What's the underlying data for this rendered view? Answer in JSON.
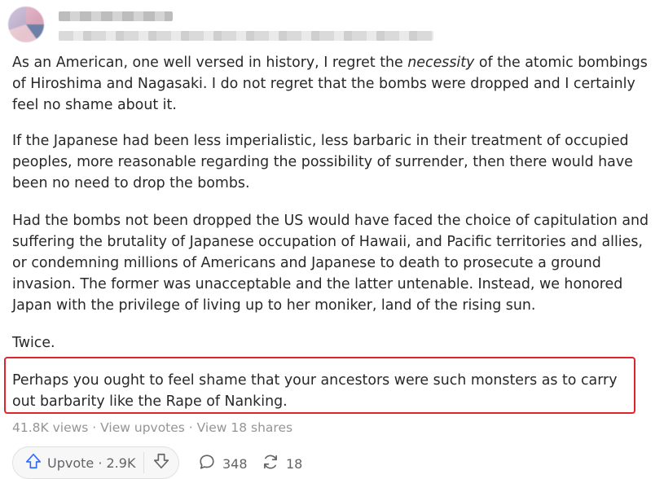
{
  "answer": {
    "paragraphs": {
      "p1_before": "As an American, one well versed in history, I regret the ",
      "p1_emph": "necessity",
      "p1_after": " of the atomic bombings of Hiroshima and Nagasaki. I do not regret that the bombs were dropped and I certainly feel no shame about it.",
      "p2": "If the Japanese had been less imperialistic, less barbaric in their treatment of occupied peoples, more reasonable regarding the possibility of surrender, then there would have been no need to drop the bombs.",
      "p3": "Had the bombs not been dropped the US would have faced the choice of capitulation and suffering the brutality of Japanese occupation of Hawaii, and Pacific territories and allies, or condemning millions of Americans and Japanese to death to prosecute a ground invasion. The former was unacceptable and the latter untenable. Instead, we honored Japan with the privilege of living up to her moniker, land of the rising sun.",
      "p4": "Twice.",
      "p5": "Perhaps you ought to feel shame that your ancestors were such monsters as to carry out barbarity like the Rape of Nanking."
    },
    "stats": {
      "views": "41.8K views",
      "sep1": " · ",
      "upvotes_link": "View upvotes",
      "sep2": " · ",
      "shares_link": "View 18 shares"
    },
    "actions": {
      "upvote_label": "Upvote · 2.9K",
      "comments_count": "348",
      "shares_count": "18"
    }
  },
  "colors": {
    "text": "#282829",
    "muted": "#939598",
    "highlight_border": "#e0242b",
    "upvote_icon": "#2e69ff"
  },
  "icons": [
    "avatar",
    "upvote-arrow-icon",
    "downvote-arrow-icon",
    "comment-bubble-icon",
    "share-cycle-icon"
  ]
}
